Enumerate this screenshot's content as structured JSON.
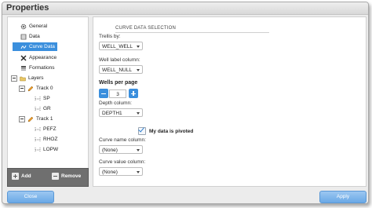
{
  "window": {
    "title": "Properties"
  },
  "tree": {
    "items": [
      {
        "label": "General",
        "icon": "gear-icon"
      },
      {
        "label": "Data",
        "icon": "data-icon"
      },
      {
        "label": "Curve Data",
        "icon": "curve-data-icon",
        "selected": true
      },
      {
        "label": "Appearance",
        "icon": "tools-icon"
      },
      {
        "label": "Formations",
        "icon": "formations-icon"
      },
      {
        "label": "Layers",
        "icon": "folder-icon"
      },
      {
        "label": "Track 0",
        "icon": "pencil-icon"
      },
      {
        "label": "SP",
        "icon": "curve-icon"
      },
      {
        "label": "GR",
        "icon": "curve-icon"
      },
      {
        "label": "Track 1",
        "icon": "pencil-icon"
      },
      {
        "label": "PEFZ",
        "icon": "curve-icon"
      },
      {
        "label": "RHOZ",
        "icon": "curve-icon"
      },
      {
        "label": "LOPW",
        "icon": "curve-icon"
      }
    ],
    "add_label": "Add",
    "remove_label": "Remove"
  },
  "panel": {
    "section_title": "CURVE DATA SELECTION",
    "trellis_by": {
      "label": "Trellis by:",
      "value": "WELL_WELL"
    },
    "well_label_column": {
      "label": "Well label column:",
      "value": "WELL_NULL"
    },
    "wells_per_page": {
      "label": "Wells per page",
      "value": "3"
    },
    "depth_column": {
      "label": "Depth column:",
      "value": "DEPTH1"
    },
    "pivoted": {
      "label": "My data is pivoted",
      "checked": true
    },
    "curve_name_column": {
      "label": "Curve name column:",
      "value": "(None)"
    },
    "curve_value_column": {
      "label": "Curve value column:",
      "value": "(None)"
    }
  },
  "footer": {
    "close_label": "Close",
    "apply_label": "Apply"
  },
  "colors": {
    "accent": "#3b8fdd",
    "button": "#7ab3ea"
  }
}
